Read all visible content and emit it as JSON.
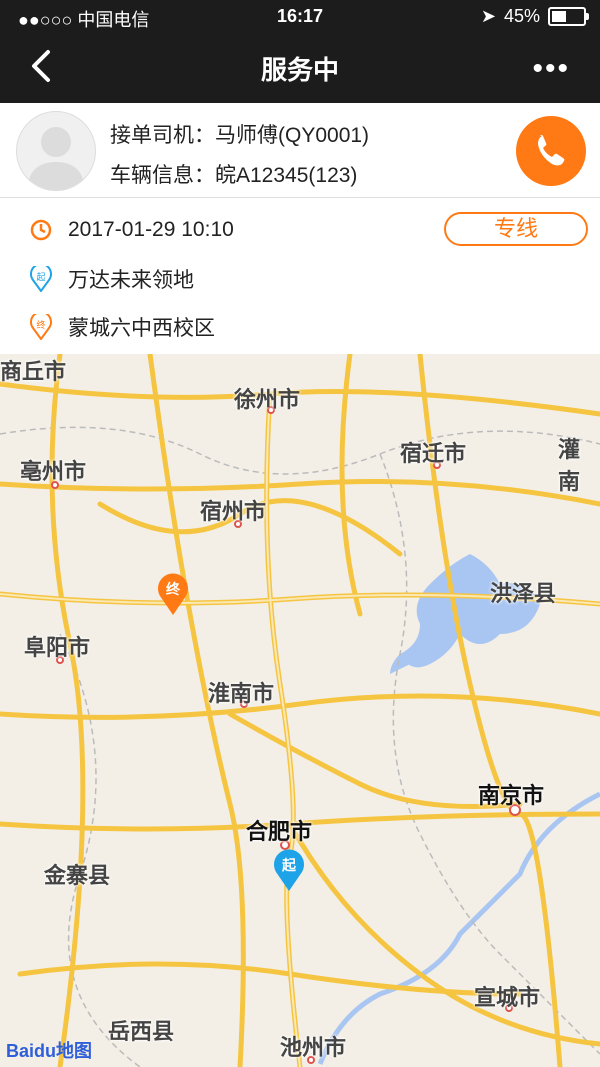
{
  "status_bar": {
    "carrier": "●●○○○ 中国电信",
    "time": "16:17",
    "battery": "45%",
    "battery_level": 0.45
  },
  "nav": {
    "title": "服务中",
    "more": "•••"
  },
  "driver": {
    "driver_label": "接单司机：马师傅(QY0001)",
    "vehicle_label": "车辆信息：皖A12345(123)"
  },
  "trip": {
    "time": "2017-01-29 10:10",
    "line_type": "专线",
    "start": "万达未来领地",
    "end": "蒙城六中西校区",
    "start_badge": "起",
    "end_badge": "终"
  },
  "map": {
    "cities": [
      "商丘市",
      "徐州市",
      "宿迁市",
      "灌南",
      "亳州市",
      "宿州市",
      "洪泽县",
      "阜阳市",
      "淮南市",
      "南京市",
      "合肥市",
      "金寨县",
      "宣城市",
      "岳西县",
      "池州市"
    ],
    "logo": "Baidu地图",
    "start_pin": "起",
    "end_pin": "终"
  },
  "colors": {
    "accent": "#ff7a14",
    "start": "#1fa3e8",
    "road": "#f5c542"
  }
}
